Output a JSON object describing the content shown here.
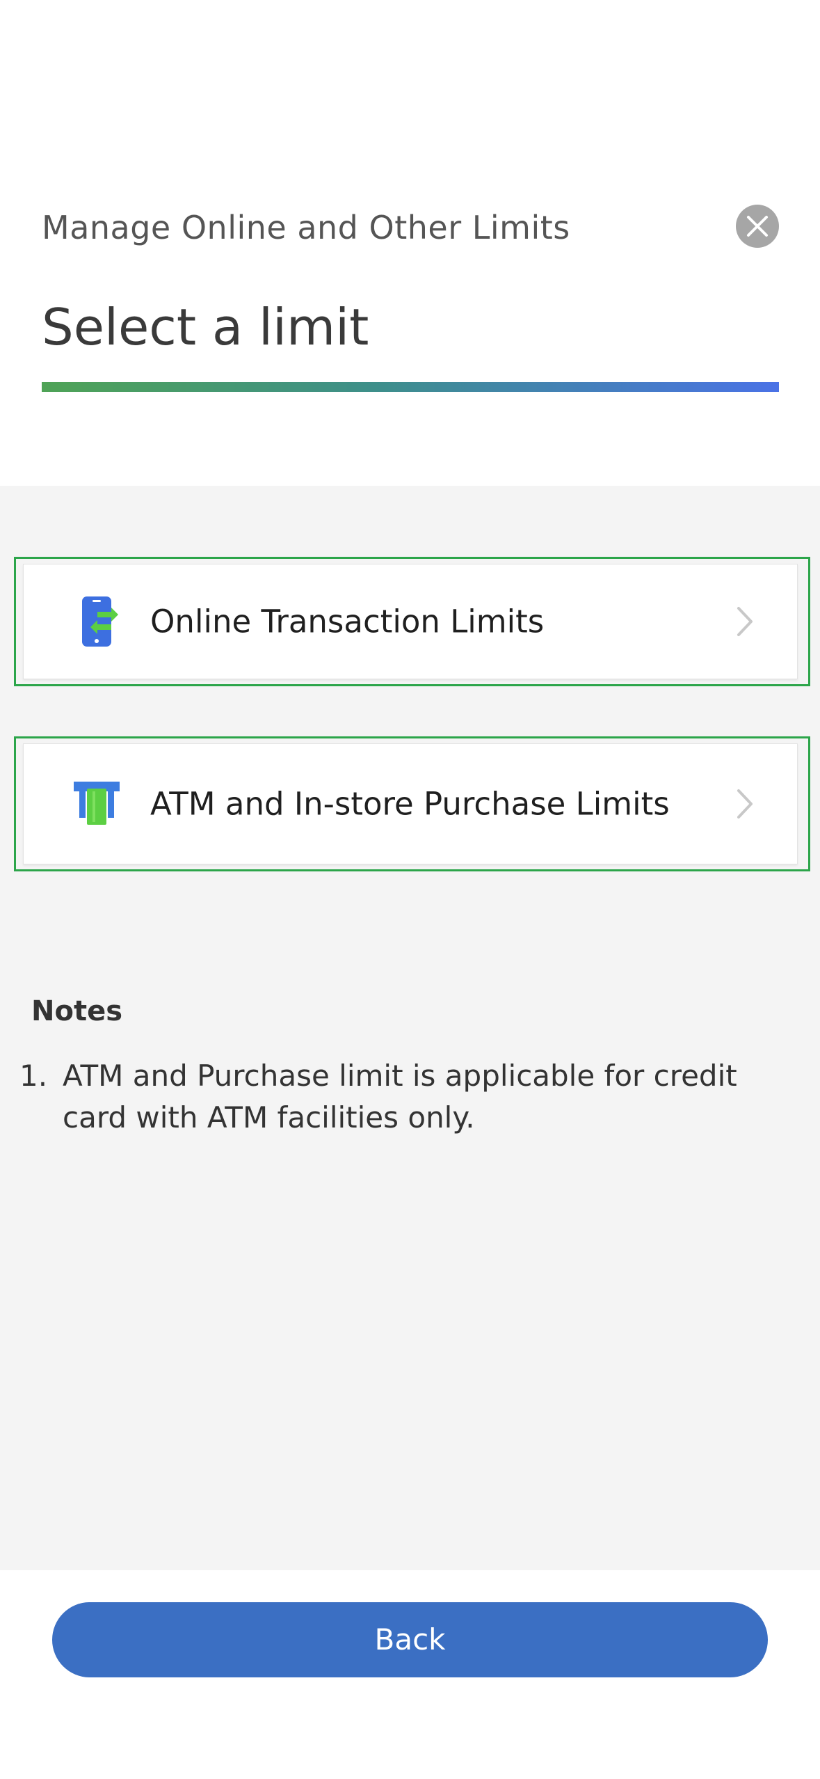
{
  "header": {
    "subtitle": "Manage Online and Other Limits",
    "title": "Select a limit",
    "close_icon": "close-icon"
  },
  "limits": [
    {
      "label": "Online Transaction Limits",
      "icon": "mobile-transfer-icon"
    },
    {
      "label": "ATM and In-store Purchase Limits",
      "icon": "atm-card-icon"
    }
  ],
  "notes": {
    "title": "Notes",
    "items": [
      {
        "number": "1.",
        "text": "ATM and Purchase limit is applicable for credit card with ATM facilities only."
      }
    ]
  },
  "footer": {
    "back_label": "Back"
  },
  "colors": {
    "accent_blue": "#3b6fc3",
    "highlight_green": "#2ca54a",
    "gradient_start": "#4fa356",
    "gradient_end": "#4a72e6",
    "content_bg": "#f4f4f4"
  }
}
